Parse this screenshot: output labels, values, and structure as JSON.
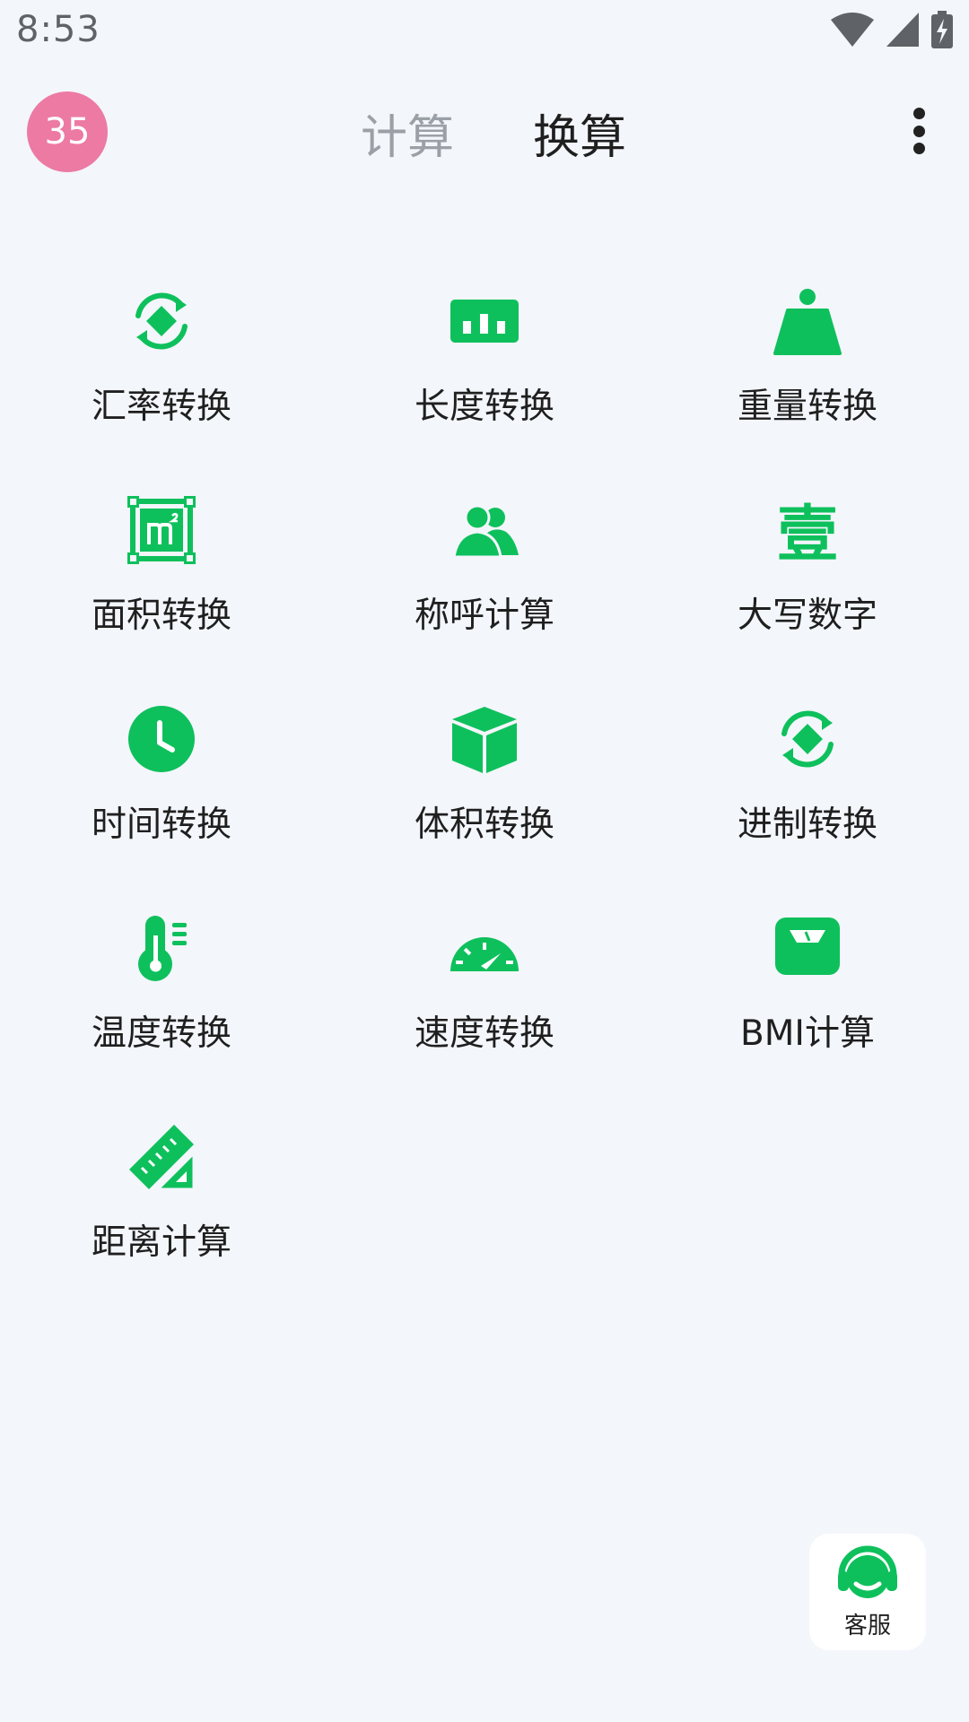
{
  "status_bar": {
    "time": "8:53",
    "icons": [
      "wifi-icon",
      "cell-signal-icon",
      "battery-charging-icon"
    ]
  },
  "header": {
    "avatar_text": "35",
    "tabs": [
      {
        "label": "计算",
        "active": false
      },
      {
        "label": "换算",
        "active": true
      }
    ],
    "menu_icon": "more-vert-icon"
  },
  "accent_color": "#0ec05c",
  "grid": {
    "items": [
      {
        "label": "汇率转换",
        "icon": "exchange-rate-icon"
      },
      {
        "label": "长度转换",
        "icon": "ruler-length-icon"
      },
      {
        "label": "重量转换",
        "icon": "weight-icon"
      },
      {
        "label": "面积转换",
        "icon": "area-m2-icon"
      },
      {
        "label": "称呼计算",
        "icon": "people-icon"
      },
      {
        "label": "大写数字",
        "icon": "chinese-numeral-icon"
      },
      {
        "label": "时间转换",
        "icon": "clock-icon"
      },
      {
        "label": "体积转换",
        "icon": "cube-icon"
      },
      {
        "label": "进制转换",
        "icon": "base-convert-icon"
      },
      {
        "label": "温度转换",
        "icon": "thermometer-icon"
      },
      {
        "label": "速度转换",
        "icon": "speedometer-icon"
      },
      {
        "label": "BMI计算",
        "icon": "scale-icon"
      },
      {
        "label": "距离计算",
        "icon": "triangle-ruler-icon"
      }
    ]
  },
  "icon_glyphs": {
    "chinese_numeral": "壹"
  },
  "service": {
    "label": "客服",
    "icon": "headset-icon"
  }
}
